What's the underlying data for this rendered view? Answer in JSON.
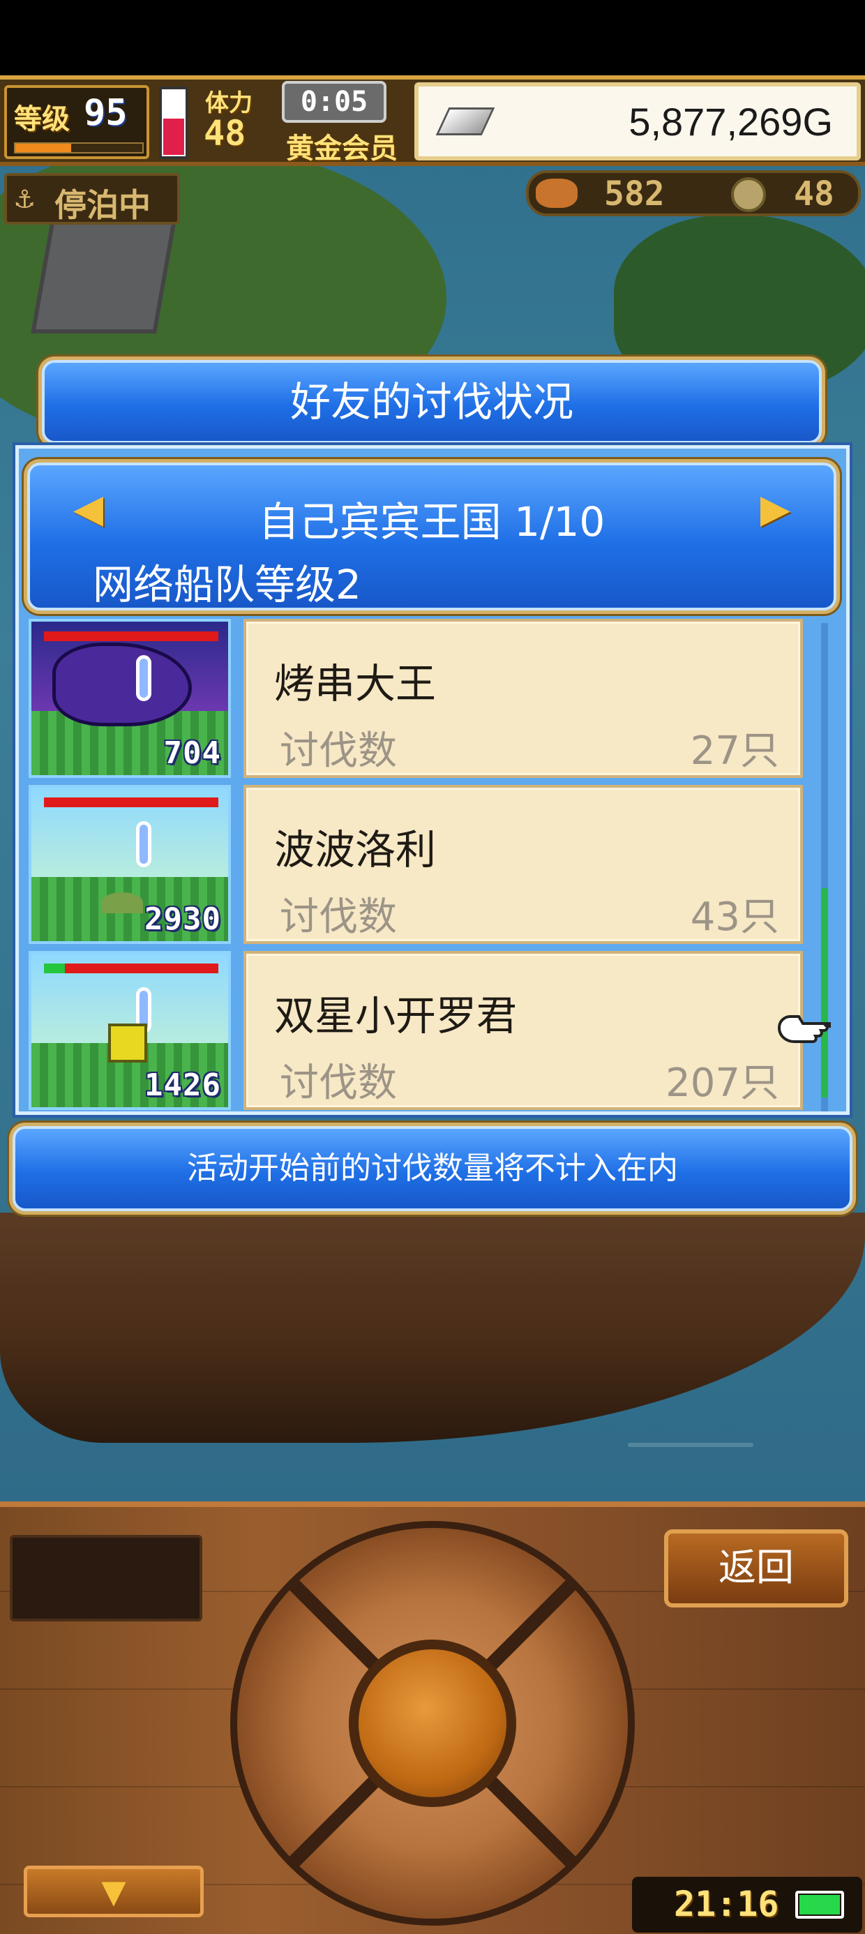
{
  "hud": {
    "level_label": "等级",
    "level_value": "95",
    "crew_label": "体力",
    "crew_value": "48",
    "timer": "0:05",
    "membership": "黄金会员",
    "gold": "5,877,269G",
    "anchor_status": "停泊中",
    "resource1_value": "582",
    "resource2_value": "48"
  },
  "dialog": {
    "title": "好友的讨伐状况",
    "kingdom": "自己宾宾王国 1/10",
    "fleet_level": "网络船队等级2",
    "footer_note": "活动开始前的讨伐数量将不计入在内",
    "entries": [
      {
        "name": "烤串大王",
        "label": "讨伐数",
        "count": "27只",
        "damage": "704",
        "hp_ratio": 1.0
      },
      {
        "name": "波波洛利",
        "label": "讨伐数",
        "count": "43只",
        "damage": "2930",
        "hp_ratio": 1.0
      },
      {
        "name": "双星小开罗君",
        "label": "讨伐数",
        "count": "207只",
        "damage": "1426",
        "hp_ratio": 0.88
      }
    ]
  },
  "controls": {
    "back_button": "返回",
    "clock": "21:16"
  },
  "colors": {
    "banner_blue": "#1f6fe6",
    "card_bg": "#f7e8c6",
    "gold_text": "#ffe27a",
    "hp_red": "#e01a1a",
    "hp_green": "#23c63d"
  },
  "icons": [
    "anchor-icon",
    "silver-ingot-icon",
    "left-arrow-icon",
    "right-arrow-icon",
    "pointing-hand-icon",
    "down-arrow-icon",
    "battery-icon"
  ]
}
